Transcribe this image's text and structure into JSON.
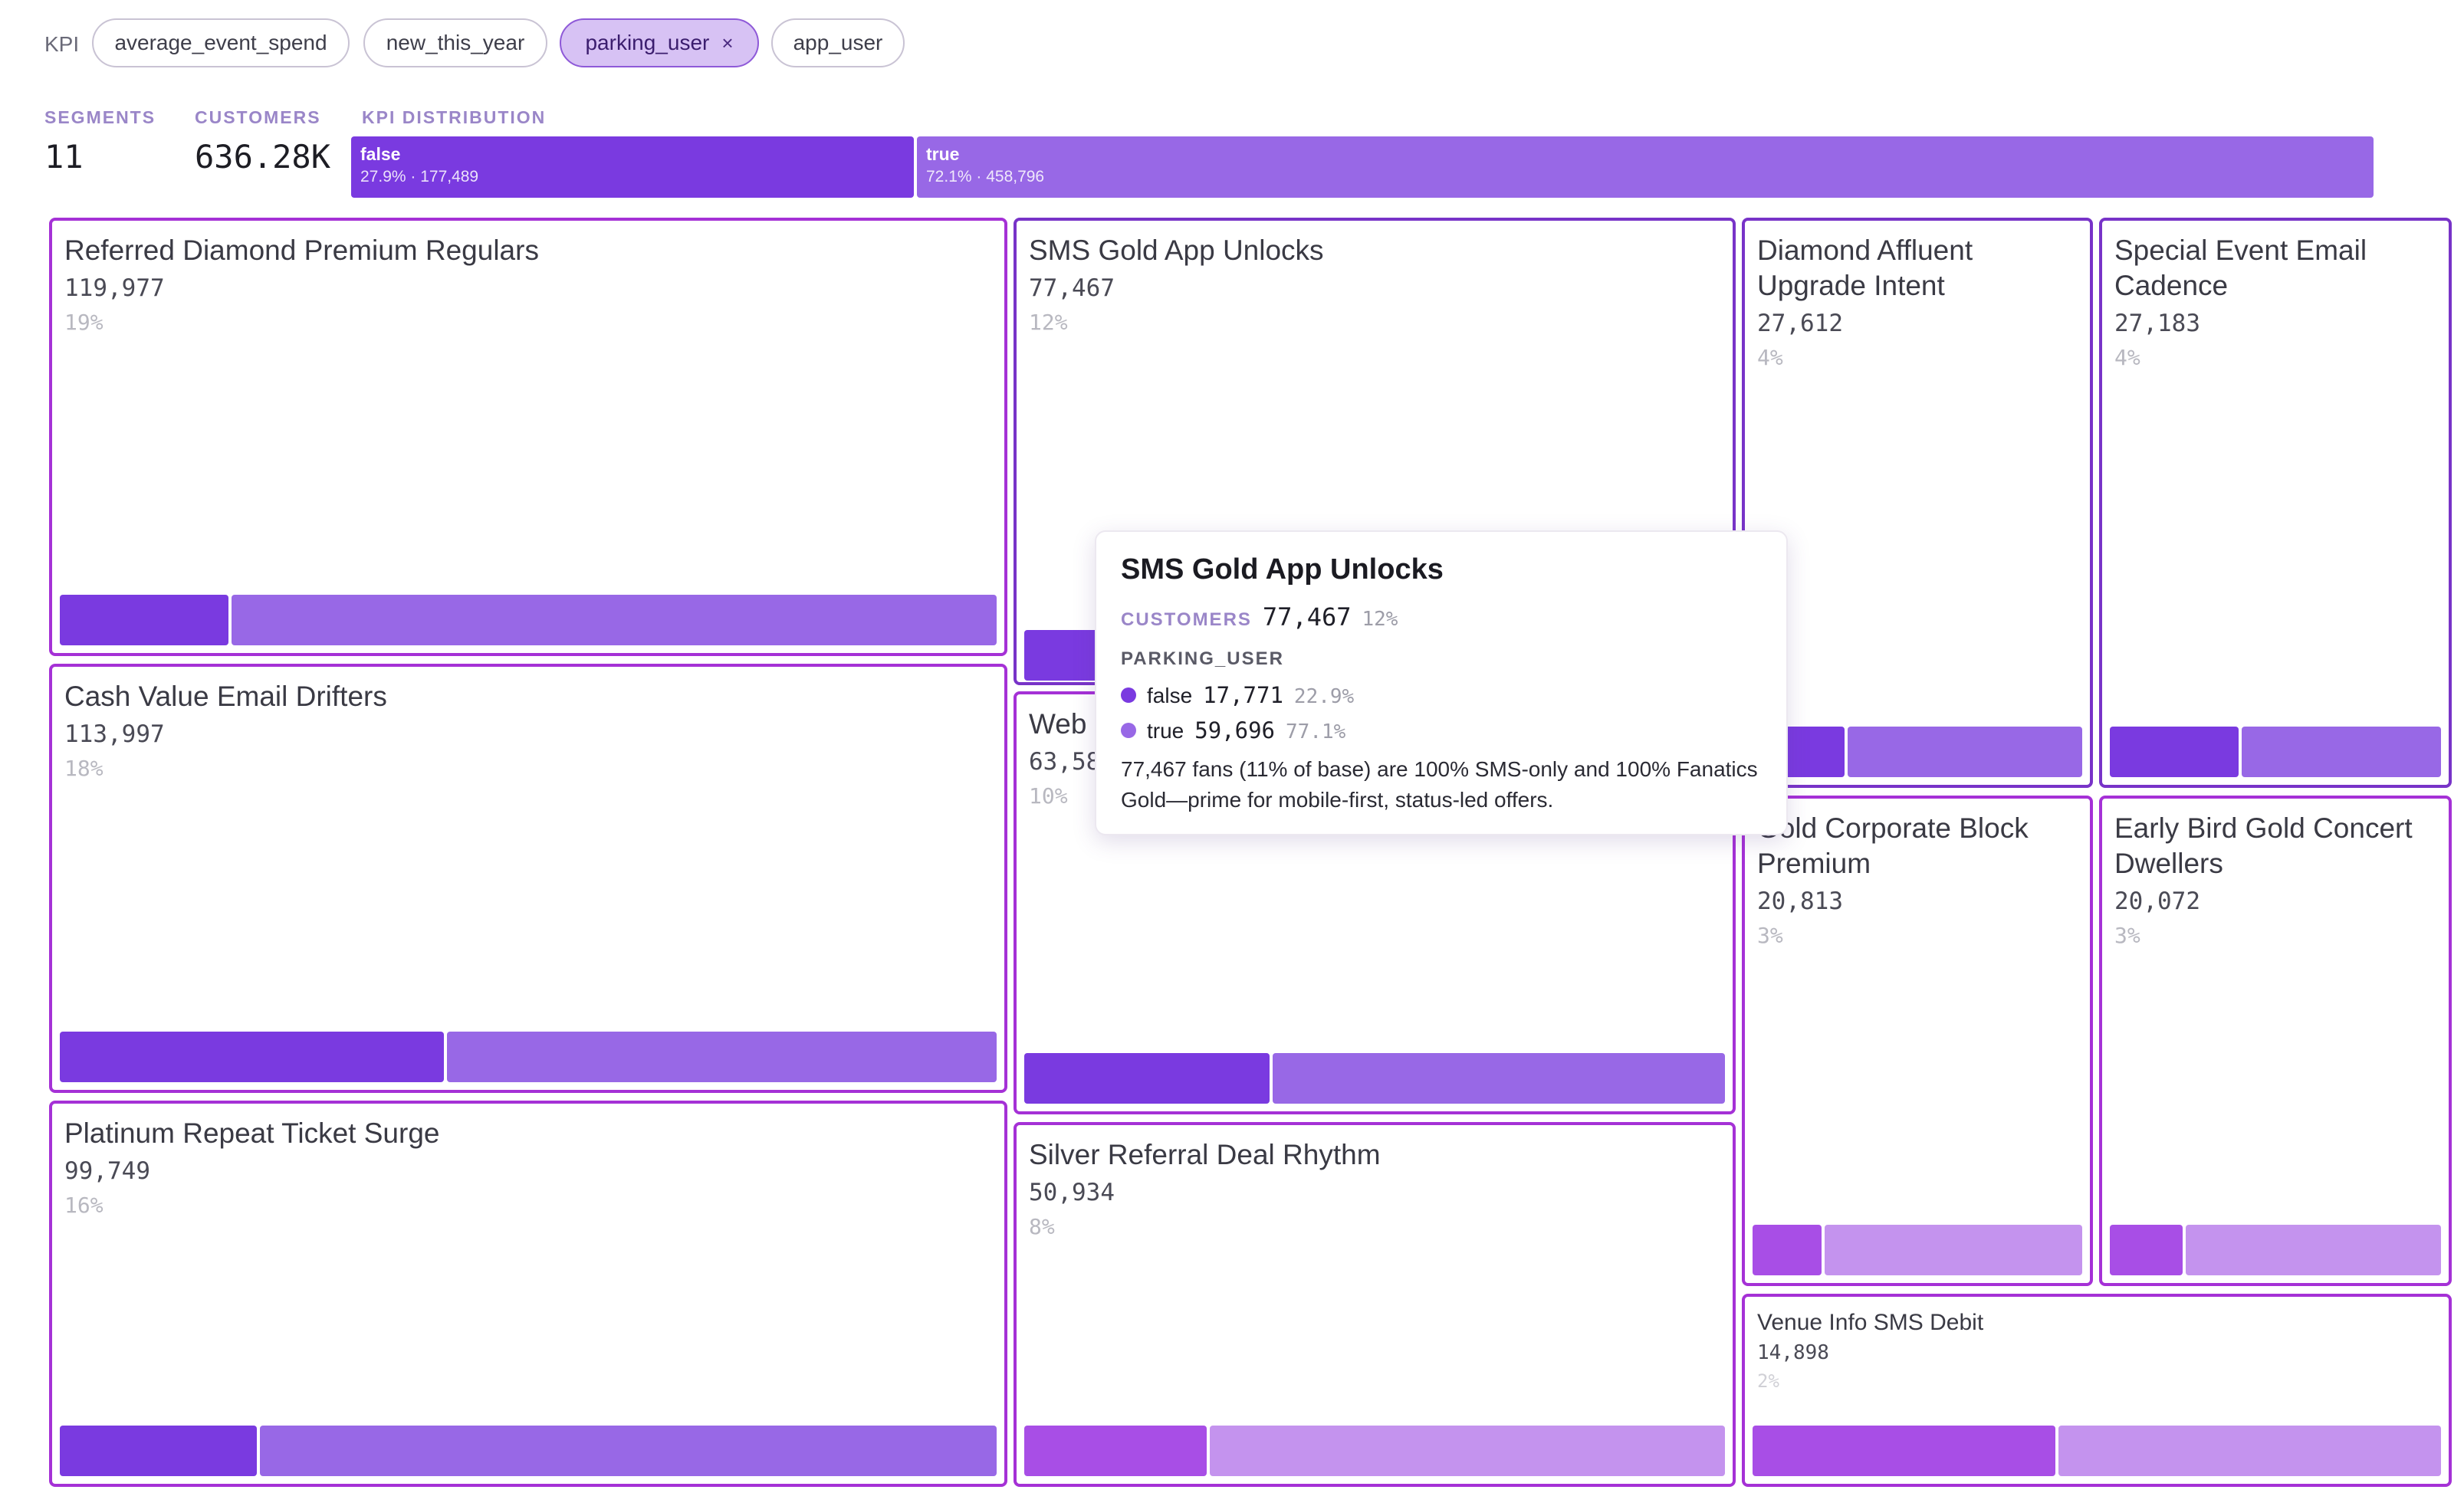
{
  "kpi": {
    "label": "KPI",
    "chips": [
      {
        "label": "average_event_spend",
        "active": false
      },
      {
        "label": "new_this_year",
        "active": false
      },
      {
        "label": "parking_user",
        "active": true,
        "close": "×"
      },
      {
        "label": "app_user",
        "active": false
      }
    ]
  },
  "stats": {
    "segments_label": "SEGMENTS",
    "segments_value": "11",
    "customers_label": "CUSTOMERS",
    "customers_value": "636.28K",
    "distribution_label": "KPI DISTRIBUTION"
  },
  "distribution": [
    {
      "name": "false",
      "detail": "27.9% · 177,489",
      "share": 0.279,
      "color": "#7a3ae0"
    },
    {
      "name": "true",
      "detail": "72.1% · 458,796",
      "share": 0.721,
      "color": "#9868e6"
    }
  ],
  "segments": [
    {
      "title": "Referred Diamond Premium Regulars",
      "count": "119,977",
      "pct": "19%",
      "false_share": 0.18
    },
    {
      "title": "SMS Gold App Unlocks",
      "count": "77,467",
      "pct": "12%",
      "false_share": 0.229
    },
    {
      "title": "Diamond Affluent Upgrade Intent",
      "count": "27,612",
      "pct": "4%",
      "false_share": 0.28
    },
    {
      "title": "Special Event Email Cadence",
      "count": "27,183",
      "pct": "4%",
      "false_share": 0.39
    },
    {
      "title": "Cash Value Email Drifters",
      "count": "113,997",
      "pct": "18%",
      "false_share": 0.41
    },
    {
      "title": "Web",
      "count": "63,58",
      "pct": "10%",
      "false_share": 0.35
    },
    {
      "title": "Gold Corporate Block Premium",
      "count": "20,813",
      "pct": "3%",
      "false_share": 0.21
    },
    {
      "title": "Early Bird Gold Concert Dwellers",
      "count": "20,072",
      "pct": "3%",
      "false_share": 0.22
    },
    {
      "title": "Platinum Repeat Ticket Surge",
      "count": "99,749",
      "pct": "16%",
      "false_share": 0.21
    },
    {
      "title": "Silver Referral Deal Rhythm",
      "count": "50,934",
      "pct": "8%",
      "false_share": 0.26
    },
    {
      "title": "Venue Info SMS Debit",
      "count": "14,898",
      "pct": "2%",
      "false_share": 0.44
    }
  ],
  "tooltip": {
    "title": "SMS Gold App Unlocks",
    "customers_label": "CUSTOMERS",
    "customers_value": "77,467",
    "customers_pct": "12%",
    "kpi_label": "PARKING_USER",
    "rows": [
      {
        "key": "false",
        "value": "17,771",
        "pct": "22.9%",
        "color": "#7a3ae0"
      },
      {
        "key": "true",
        "value": "59,696",
        "pct": "77.1%",
        "color": "#9868e6"
      }
    ],
    "description": "77,467 fans (11% of base) are 100% SMS-only and 100% Fanatics Gold—prime for mobile-first, status-led offers."
  },
  "colors": {
    "false_dark": "#7a3ae0",
    "true_light": "#9868e6",
    "false_magenta": "#a84ee6",
    "true_pale": "#c493ee"
  }
}
